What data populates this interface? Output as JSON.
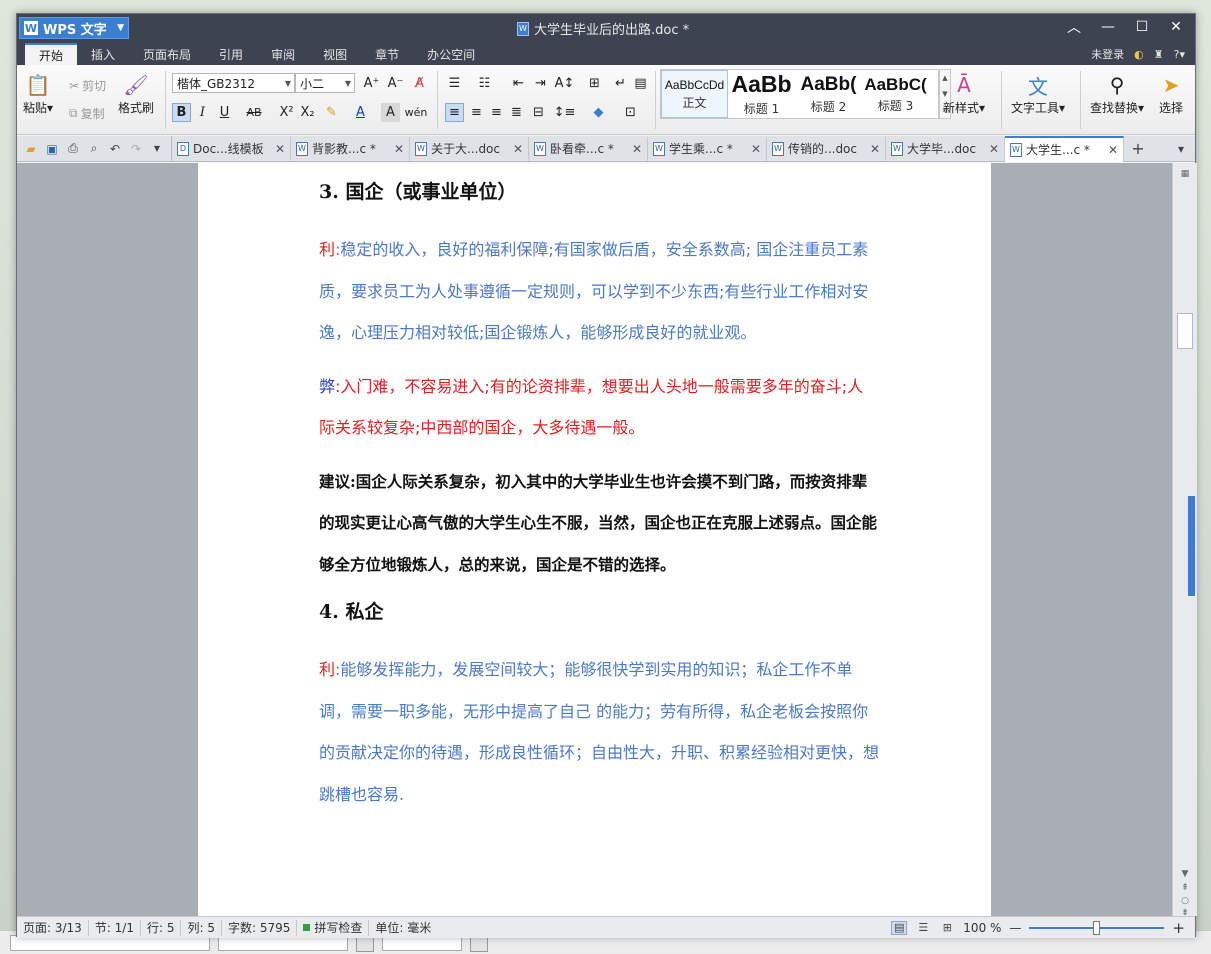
{
  "app": {
    "name": "WPS 文字",
    "doc_title": "大学生毕业后的出路.doc *"
  },
  "menu": {
    "tabs": [
      "开始",
      "插入",
      "页面布局",
      "引用",
      "审阅",
      "视图",
      "章节",
      "办公空间"
    ],
    "login": "未登录"
  },
  "ribbon": {
    "paste": "粘贴",
    "cut": "剪切",
    "copy": "复制",
    "format_painter": "格式刷",
    "font_name": "楷体_GB2312",
    "font_size": "小二",
    "styles": [
      {
        "sample": "AaBbCcDd",
        "name": "正文"
      },
      {
        "sample": "AaBb",
        "name": "标题 1"
      },
      {
        "sample": "AaBb(",
        "name": "标题 2"
      },
      {
        "sample": "AaBbC(",
        "name": "标题 3"
      }
    ],
    "new_style": "新样式",
    "text_tools": "文字工具",
    "find_replace": "查找替换",
    "select": "选择"
  },
  "doc_tabs": [
    {
      "label": "Doc...线模板",
      "icon": "D"
    },
    {
      "label": "背影教...c *",
      "icon": "W"
    },
    {
      "label": "关于大...doc",
      "icon": "W"
    },
    {
      "label": "卧看牵...c *",
      "icon": "W"
    },
    {
      "label": "学生乘...c *",
      "icon": "W"
    },
    {
      "label": "传销的...doc",
      "icon": "W"
    },
    {
      "label": "大学毕...doc",
      "icon": "W"
    },
    {
      "label": "大学生...c *",
      "icon": "W"
    }
  ],
  "document": {
    "heading3": "3. 国企（或事业单位）",
    "p1_label": "利",
    "p1_text": ":稳定的收入，良好的福利保障;有国家做后盾，安全系数高;  国企注重员工素质，要求员工为人处事遵循一定规则，可以学到不少东西;有些行业工作相对安逸，心理压力相对较低;国企锻炼人，能够形成良好的就业观。",
    "p2_label": "弊",
    "p2_text": ":入门难，不容易进入;有的论资排辈，想要出人头地一般需要多年的奋斗;人际关系较复杂;中西部的国企，大多待遇一般。",
    "p3_text": "建议:国企人际关系复杂，初入其中的大学毕业生也许会摸不到门路，而按资排辈的现实更让心高气傲的大学生心生不服，当然，国企也正在克服上述弱点。国企能够全方位地锻炼人，总的来说，国企是不错的选择。",
    "heading4": "4. 私企",
    "p4_label": "利",
    "p4_text": ":能够发挥能力，发展空间较大；能够很快学到实用的知识；私企工作不单调，需要一职多能，无形中提高了自己 的能力；劳有所得，私企老板会按照你的贡献决定你的待遇，形成良性循环；自由性大，升职、积累经验相对更快，想跳槽也容易."
  },
  "status": {
    "page": "页面: 3/13",
    "section": "节: 1/1",
    "row": "行: 5",
    "col": "列: 5",
    "word_count": "字数: 5795",
    "spell_check": "拼写检查",
    "unit": "单位: 毫米",
    "zoom": "100 %"
  },
  "zoom_fraction": 0.5,
  "colors": {
    "accent": "#3a7fd0",
    "red": "#e02020",
    "blue_text": "#4a7ac8",
    "titlebar": "#3d4350"
  }
}
